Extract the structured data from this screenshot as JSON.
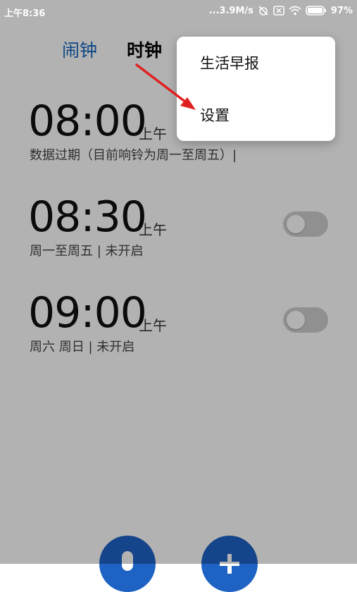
{
  "status_bar": {
    "time": "上午8:36",
    "network_speed": "...3.9M/s",
    "battery": "97%"
  },
  "tabs": {
    "alarm": "闹钟",
    "clock": "时钟"
  },
  "alarms": [
    {
      "time": "08:00",
      "ampm": "上午",
      "description": "数据过期（目前响铃为周一至周五）|",
      "enabled": false,
      "toggle_visible": false
    },
    {
      "time": "08:30",
      "ampm": "上午",
      "description": "周一至周五 | 未开启",
      "enabled": false,
      "toggle_visible": true
    },
    {
      "time": "09:00",
      "ampm": "上午",
      "description": "周六 周日 | 未开启",
      "enabled": false,
      "toggle_visible": true
    }
  ],
  "menu": {
    "items": [
      {
        "label": "生活早报"
      },
      {
        "label": "设置"
      }
    ]
  },
  "icons": {
    "voice_fab": "microphone-icon",
    "add_fab": "plus-icon"
  },
  "colors": {
    "accent": "#1565c0",
    "fab": "#1e62c4",
    "annotation_arrow": "#e02020"
  }
}
